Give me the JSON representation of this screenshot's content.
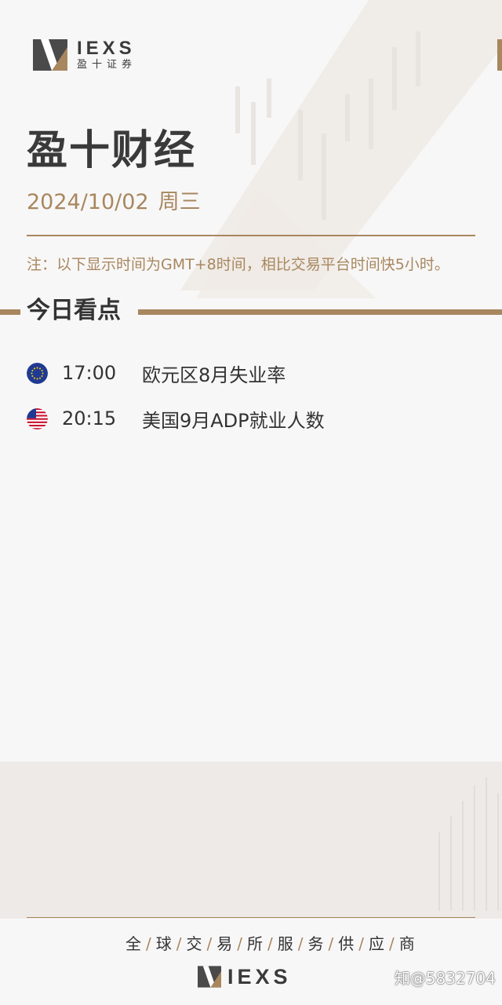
{
  "brand": {
    "logo_word": "IEXS",
    "logo_sub": "盈十证券"
  },
  "header": {
    "title": "盈十财经",
    "date": "2024/10/02",
    "weekday": "周三",
    "note": "注：以下显示时间为GMT+8时间，相比交易平台时间快5小时。"
  },
  "section": {
    "title": "今日看点"
  },
  "events": [
    {
      "flag": "eu-flag-icon",
      "time": "17:00",
      "name": "欧元区8月失业率"
    },
    {
      "flag": "us-flag-icon",
      "time": "20:15",
      "name": "美国9月ADP就业人数"
    }
  ],
  "footer": {
    "tagline_chars": [
      "全",
      "球",
      "交",
      "易",
      "所",
      "服",
      "务",
      "供",
      "应",
      "商"
    ],
    "logo_word": "IEXS",
    "watermark": "知@5832704"
  },
  "colors": {
    "accent": "#a8875f",
    "text": "#333333",
    "background": "#f8f7f7"
  }
}
